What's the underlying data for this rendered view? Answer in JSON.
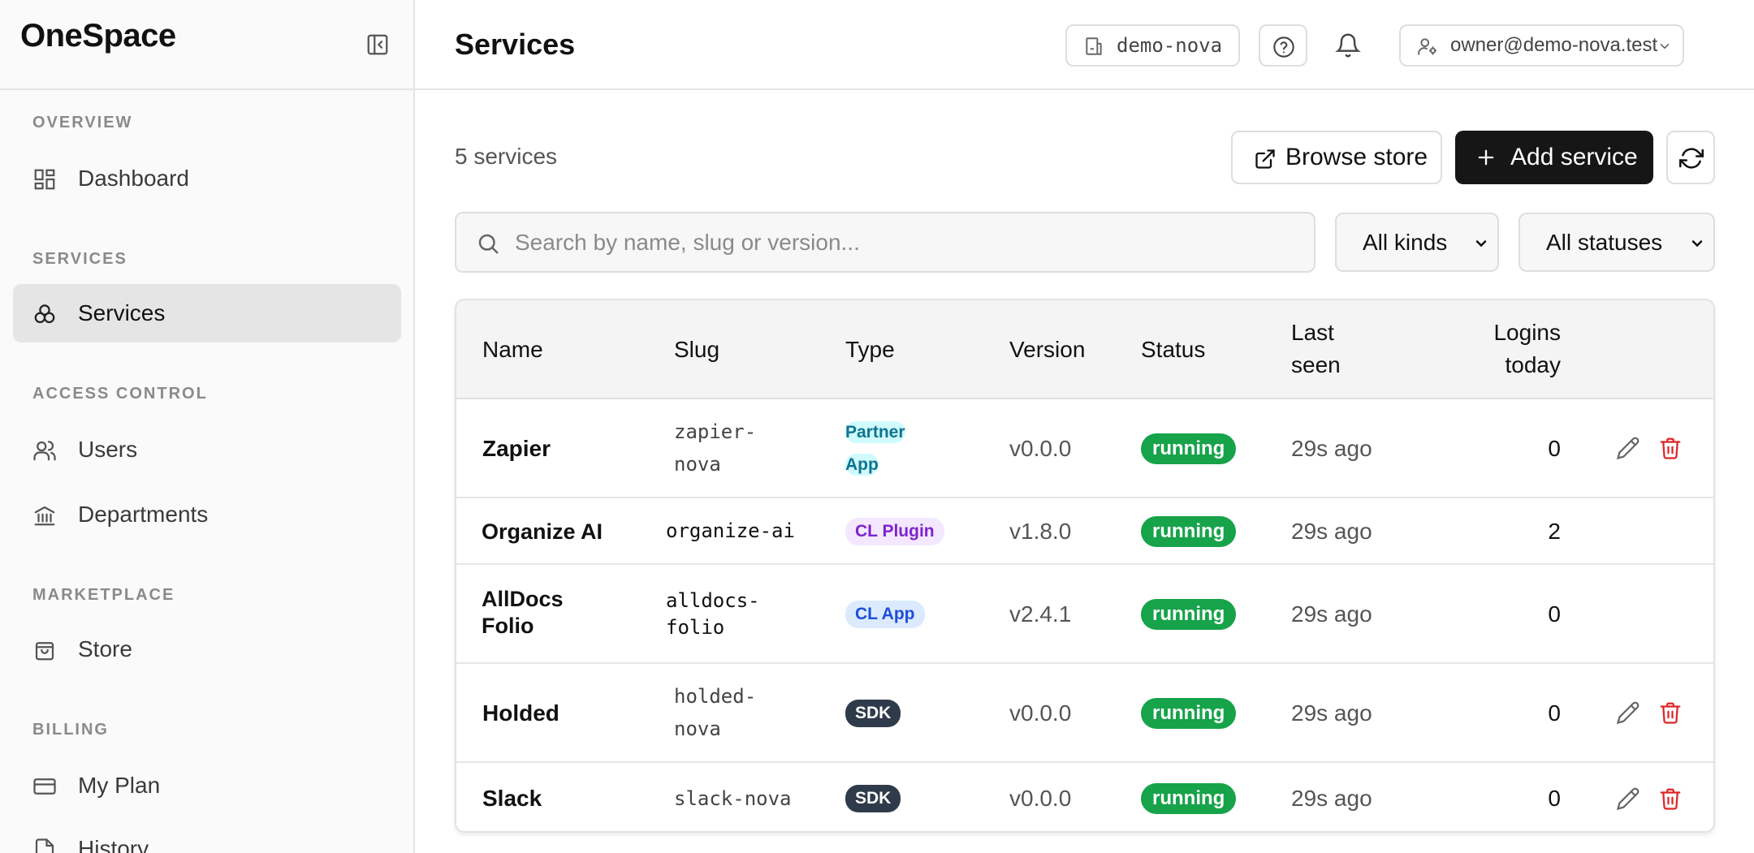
{
  "app": {
    "name": "OneSpace"
  },
  "sidebar": {
    "sections": [
      {
        "label": "OVERVIEW"
      },
      {
        "label": "SERVICES"
      },
      {
        "label": "ACCESS CONTROL"
      },
      {
        "label": "MARKETPLACE"
      },
      {
        "label": "BILLING"
      }
    ],
    "items": [
      {
        "label": "Dashboard",
        "icon": "dashboard-icon",
        "active": false
      },
      {
        "label": "Services",
        "icon": "services-icon",
        "active": true
      },
      {
        "label": "Users",
        "icon": "users-icon",
        "active": false
      },
      {
        "label": "Departments",
        "icon": "departments-icon",
        "active": false
      },
      {
        "label": "Store",
        "icon": "store-icon",
        "active": false
      },
      {
        "label": "My Plan",
        "icon": "plan-icon",
        "active": false
      },
      {
        "label": "History",
        "icon": "history-icon",
        "active": false
      }
    ]
  },
  "header": {
    "title": "Services",
    "org": "demo-nova",
    "user": "owner@demo-nova.test"
  },
  "toolbar": {
    "count": "5 services",
    "browse_label": "Browse store",
    "add_label": "Add service"
  },
  "filters": {
    "search_placeholder": "Search by name, slug or version...",
    "kinds_value": "All kinds",
    "status_value": "All statuses"
  },
  "table": {
    "columns": [
      "Name",
      "Slug",
      "Type",
      "Version",
      "Status",
      "Last seen",
      "Logins today"
    ],
    "rows": [
      {
        "name": "Zapier",
        "slug": "zapier-nova",
        "type": "Partner App",
        "version": "v0.0.0",
        "status": "running",
        "last_seen": "29s ago",
        "logins": "0",
        "actions": true
      },
      {
        "name": "Organize AI",
        "slug": "organize-ai",
        "type": "CL Plugin",
        "version": "v1.8.0",
        "status": "running",
        "last_seen": "29s ago",
        "logins": "2",
        "actions": false
      },
      {
        "name": "AllDocs Folio",
        "slug": "alldocs-folio",
        "type": "CL App",
        "version": "v2.4.1",
        "status": "running",
        "last_seen": "29s ago",
        "logins": "0",
        "actions": false
      },
      {
        "name": "Holded",
        "slug": "holded-nova",
        "type": "SDK",
        "version": "v0.0.0",
        "status": "running",
        "last_seen": "29s ago",
        "logins": "0",
        "actions": true
      },
      {
        "name": "Slack",
        "slug": "slack-nova",
        "type": "SDK",
        "version": "v0.0.0",
        "status": "running",
        "last_seen": "29s ago",
        "logins": "0",
        "actions": true
      }
    ]
  },
  "colors": {
    "running": "#16a34a",
    "delete": "#dc2626",
    "primary_button": "#161616"
  }
}
